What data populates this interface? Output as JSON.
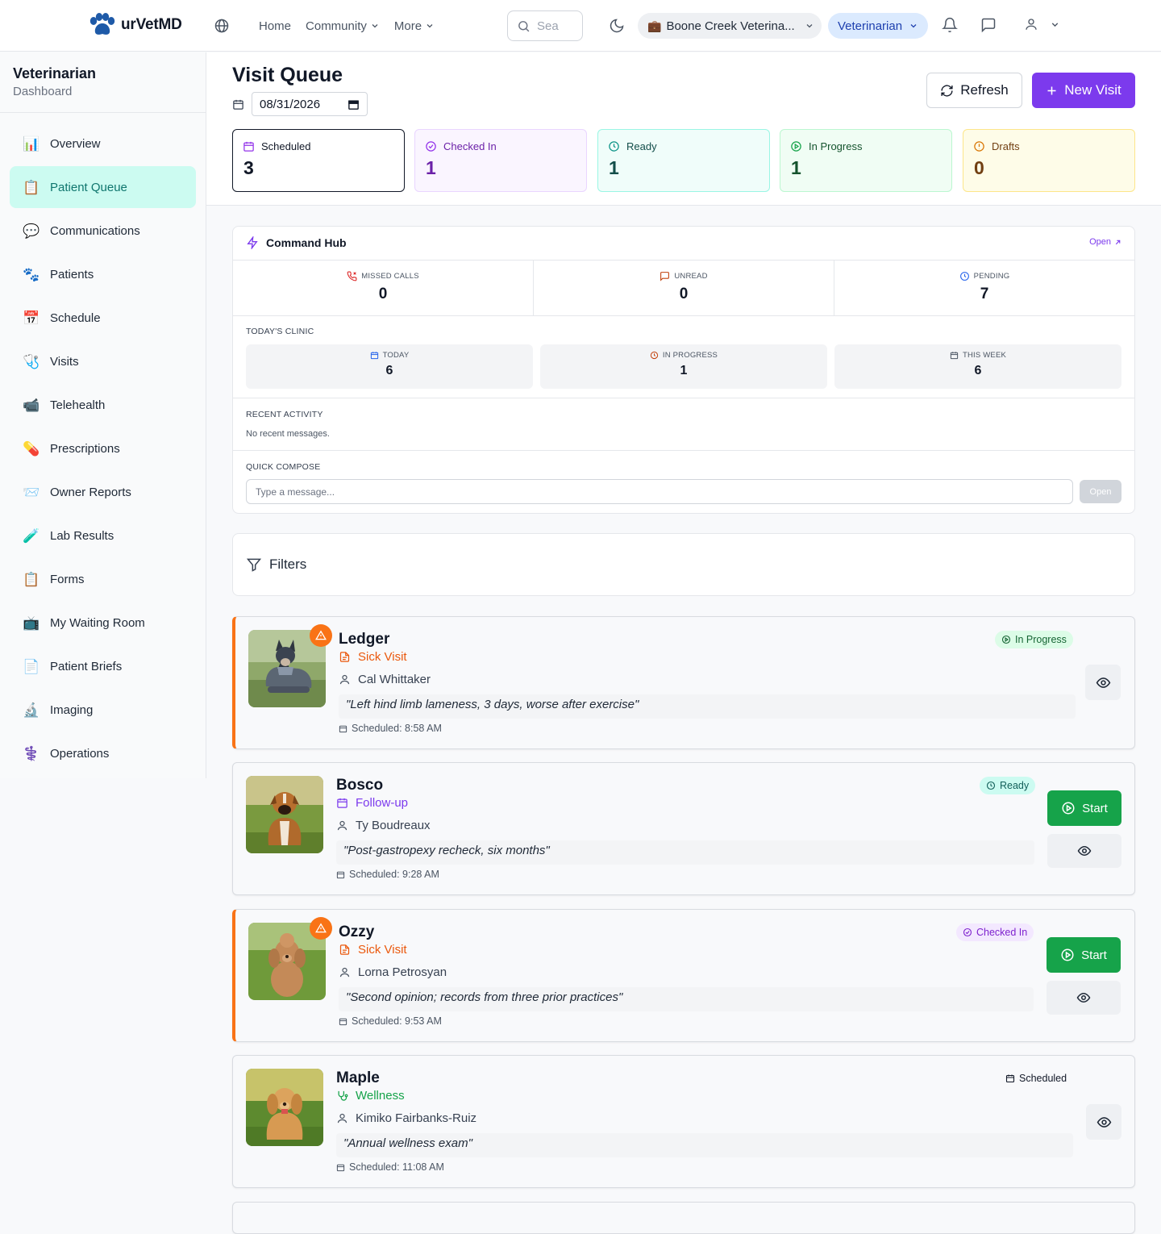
{
  "header": {
    "brand": "urVetMD",
    "nav": [
      "Home",
      "Community",
      "More"
    ],
    "search_placeholder": "Sea",
    "clinic": "Boone Creek Veterina...",
    "role": "Veterinarian"
  },
  "sidebar": {
    "title": "Veterinarian",
    "subtitle": "Dashboard",
    "items": [
      {
        "icon": "📊",
        "label": "Overview"
      },
      {
        "icon": "📋",
        "label": "Patient Queue"
      },
      {
        "icon": "💬",
        "label": "Communications"
      },
      {
        "icon": "🐾",
        "label": "Patients"
      },
      {
        "icon": "📅",
        "label": "Schedule"
      },
      {
        "icon": "🩺",
        "label": "Visits"
      },
      {
        "icon": "📹",
        "label": "Telehealth"
      },
      {
        "icon": "💊",
        "label": "Prescriptions"
      },
      {
        "icon": "📨",
        "label": "Owner Reports"
      },
      {
        "icon": "🧪",
        "label": "Lab Results"
      },
      {
        "icon": "📋",
        "label": "Forms"
      },
      {
        "icon": "📺",
        "label": "My Waiting Room"
      },
      {
        "icon": "📄",
        "label": "Patient Briefs"
      },
      {
        "icon": "🔬",
        "label": "Imaging"
      },
      {
        "icon": "⚕️",
        "label": "Operations"
      }
    ]
  },
  "queue": {
    "title": "Visit Queue",
    "date": "08/31/2026",
    "refresh_label": "Refresh",
    "new_visit_label": "New Visit",
    "stats": [
      {
        "label": "Scheduled",
        "value": "3"
      },
      {
        "label": "Checked In",
        "value": "1"
      },
      {
        "label": "Ready",
        "value": "1"
      },
      {
        "label": "In Progress",
        "value": "1"
      },
      {
        "label": "Drafts",
        "value": "0"
      }
    ]
  },
  "hub": {
    "title": "Command Hub",
    "open_label": "Open",
    "metrics": [
      {
        "label": "MISSED CALLS",
        "value": "0"
      },
      {
        "label": "UNREAD",
        "value": "0"
      },
      {
        "label": "PENDING",
        "value": "7"
      }
    ],
    "clinic_label": "TODAY'S CLINIC",
    "clinic": [
      {
        "label": "TODAY",
        "value": "6"
      },
      {
        "label": "IN PROGRESS",
        "value": "1"
      },
      {
        "label": "THIS WEEK",
        "value": "6"
      }
    ],
    "recent_label": "RECENT ACTIVITY",
    "recent_empty": "No recent messages.",
    "compose_label": "QUICK COMPOSE",
    "compose_placeholder": "Type a message...",
    "compose_button": "Open"
  },
  "filters": {
    "label": "Filters"
  },
  "visits": [
    {
      "name": "Ledger",
      "type": "Sick Visit",
      "owner": "Cal Whittaker",
      "complaint": "\"Left hind limb lameness, 3 days, worse after exercise\"",
      "scheduled": "Scheduled: 8:58 AM",
      "status": "In Progress"
    },
    {
      "name": "Bosco",
      "type": "Follow-up",
      "owner": "Ty Boudreaux",
      "complaint": "\"Post-gastropexy recheck, six months\"",
      "scheduled": "Scheduled: 9:28 AM",
      "status": "Ready",
      "start_label": "Start"
    },
    {
      "name": "Ozzy",
      "type": "Sick Visit",
      "owner": "Lorna Petrosyan",
      "complaint": "\"Second opinion; records from three prior practices\"",
      "scheduled": "Scheduled: 9:53 AM",
      "status": "Checked In",
      "start_label": "Start"
    },
    {
      "name": "Maple",
      "type": "Wellness",
      "owner": "Kimiko Fairbanks-Ruiz",
      "complaint": "\"Annual wellness exam\"",
      "scheduled": "Scheduled: 11:08 AM",
      "status": "Scheduled"
    }
  ],
  "colors": {
    "brand": "#1e5aa8",
    "accent": "#7c3aed",
    "sick": "#ea580c",
    "followup": "#7c3aed",
    "wellness": "#16a34a",
    "start": "#16a34a"
  }
}
